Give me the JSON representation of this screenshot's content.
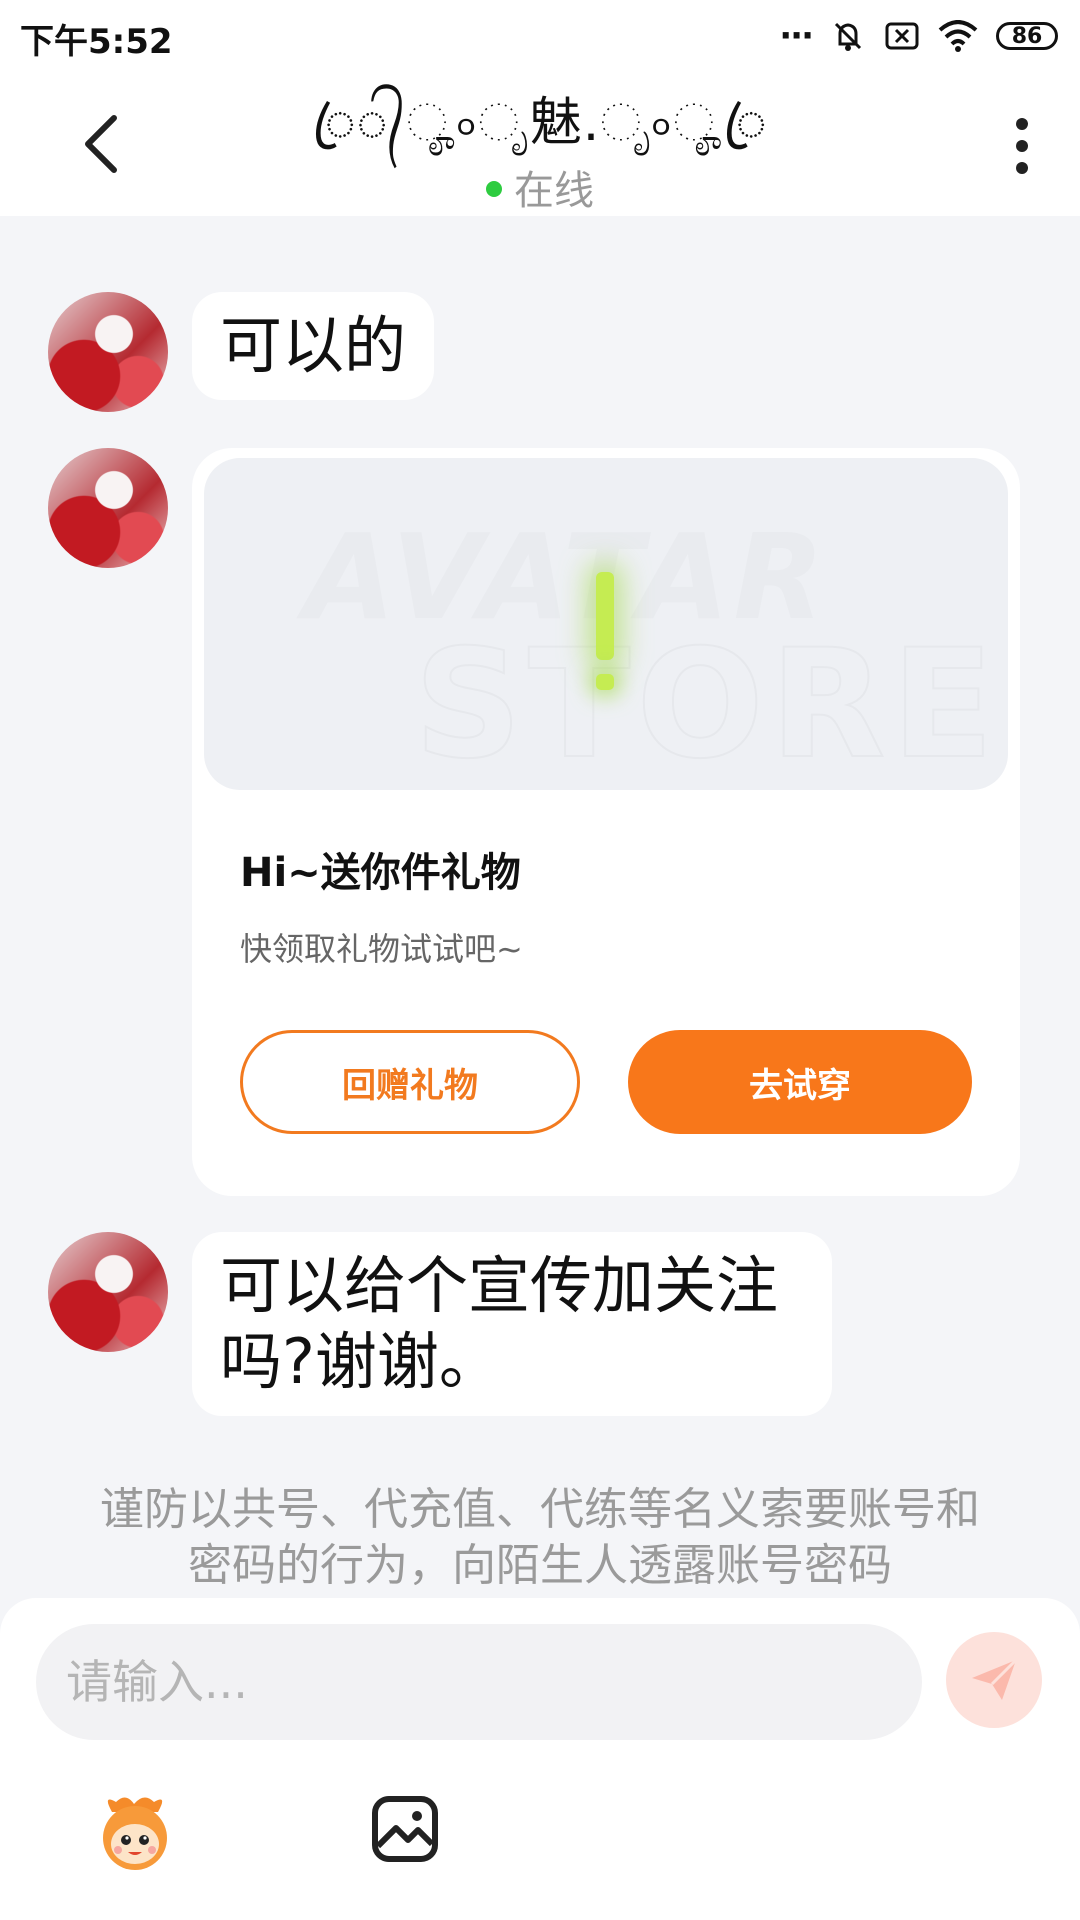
{
  "status_bar": {
    "time": "下午5:52",
    "battery": "86"
  },
  "header": {
    "title": "ꦿ᭄ೄ৹ೃ魅.ೃ৹ೄꦿ",
    "presence": "在线"
  },
  "messages": [
    {
      "text": "可以的"
    },
    {
      "text": "可以给个宣传加关注吗?谢谢。"
    }
  ],
  "gift_card": {
    "watermark_top": "AVATAR",
    "watermark_bottom": "STORE",
    "title": "Hi~送你件礼物",
    "subtitle": "快领取礼物试试吧~",
    "return_gift_label": "回赠礼物",
    "try_on_label": "去试穿"
  },
  "notice": "谨防以共号、代充值、代练等名义索要账号和密码的行为，向陌生人透露账号密码",
  "composer": {
    "placeholder": "请输入..."
  },
  "colors": {
    "accent": "#f8771a",
    "online": "#2ecc40",
    "background": "#f4f5f8"
  }
}
